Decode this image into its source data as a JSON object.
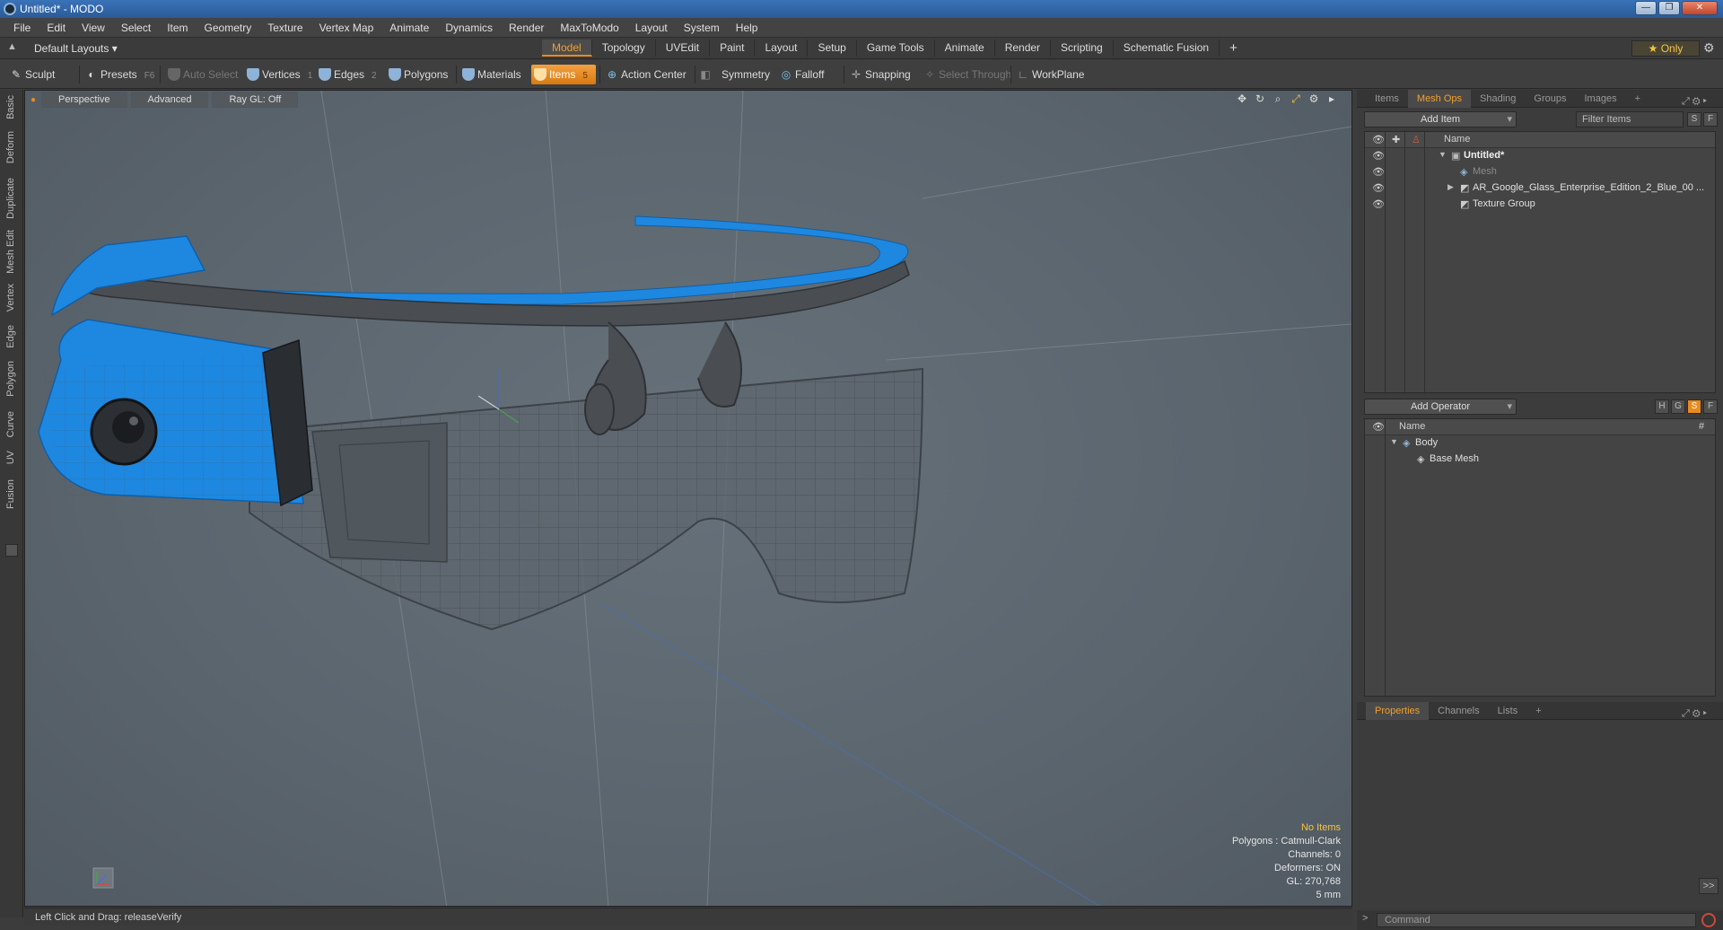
{
  "window": {
    "title": "Untitled* - MODO",
    "minimize": "—",
    "maximize": "❐",
    "close": "✕"
  },
  "menu": [
    "File",
    "Edit",
    "View",
    "Select",
    "Item",
    "Geometry",
    "Texture",
    "Vertex Map",
    "Animate",
    "Dynamics",
    "Render",
    "MaxToModo",
    "Layout",
    "System",
    "Help"
  ],
  "layoutbar": {
    "layouts_label": "Default Layouts ▾",
    "tabs": [
      "Model",
      "Topology",
      "UVEdit",
      "Paint",
      "Layout",
      "Setup",
      "Game Tools",
      "Animate",
      "Render",
      "Scripting",
      "Schematic Fusion"
    ],
    "active_tab": "Model",
    "plus": "+",
    "only_label": "★  Only"
  },
  "toolbar": {
    "sculpt": "Sculpt",
    "presets": "Presets",
    "presets_key": "F6",
    "auto_select": "Auto Select",
    "vertices": "Vertices",
    "vertices_key": "1",
    "edges": "Edges",
    "edges_key": "2",
    "polygons": "Polygons",
    "materials": "Materials",
    "items": "Items",
    "items_key": "5",
    "action_center": "Action Center",
    "symmetry": "Symmetry",
    "falloff": "Falloff",
    "snapping": "Snapping",
    "select_through": "Select Through",
    "workplane": "WorkPlane"
  },
  "left_tabs": [
    "Basic",
    "Deform",
    "Duplicate",
    "Mesh Edit",
    "Vertex",
    "Edge",
    "Polygon",
    "Curve",
    "UV",
    "Fusion"
  ],
  "viewport": {
    "view_mode": "Perspective",
    "shading": "Advanced",
    "raygl": "Ray GL: Off",
    "info": {
      "no_items": "No Items",
      "polygons": "Polygons : Catmull-Clark",
      "channels": "Channels: 0",
      "deformers": "Deformers: ON",
      "gl": "GL: 270,768",
      "scale": "5 mm"
    },
    "colors": {
      "band": "#1e88e0",
      "frame": "#4a4e52",
      "lens": "#5e666d"
    }
  },
  "status": {
    "text": "Left Click and Drag:   releaseVerify"
  },
  "items_panel": {
    "tabs": [
      "Items",
      "Mesh Ops",
      "Shading",
      "Groups",
      "Images"
    ],
    "active_tab": "Mesh Ops",
    "add_item": "Add Item",
    "filter_placeholder": "Filter Items",
    "s_btn": "S",
    "f_btn": "F",
    "name_col": "Name",
    "rows": [
      {
        "label": "Untitled*"
      },
      {
        "label": "Mesh"
      },
      {
        "label": "AR_Google_Glass_Enterprise_Edition_2_Blue_00 ..."
      },
      {
        "label": "Texture Group"
      }
    ]
  },
  "meshops_panel": {
    "add_operator": "Add Operator",
    "h_btn": "H",
    "g_btn": "G",
    "s_btn": "S",
    "f_btn": "F",
    "name_col": "Name",
    "hash_col": "#",
    "rows": [
      {
        "label": "Body"
      },
      {
        "label": "Base Mesh"
      }
    ]
  },
  "properties_panel": {
    "tabs": [
      "Properties",
      "Channels",
      "Lists"
    ],
    "active_tab": "Properties",
    "expand": ">>"
  },
  "command": {
    "placeholder": "Command"
  }
}
